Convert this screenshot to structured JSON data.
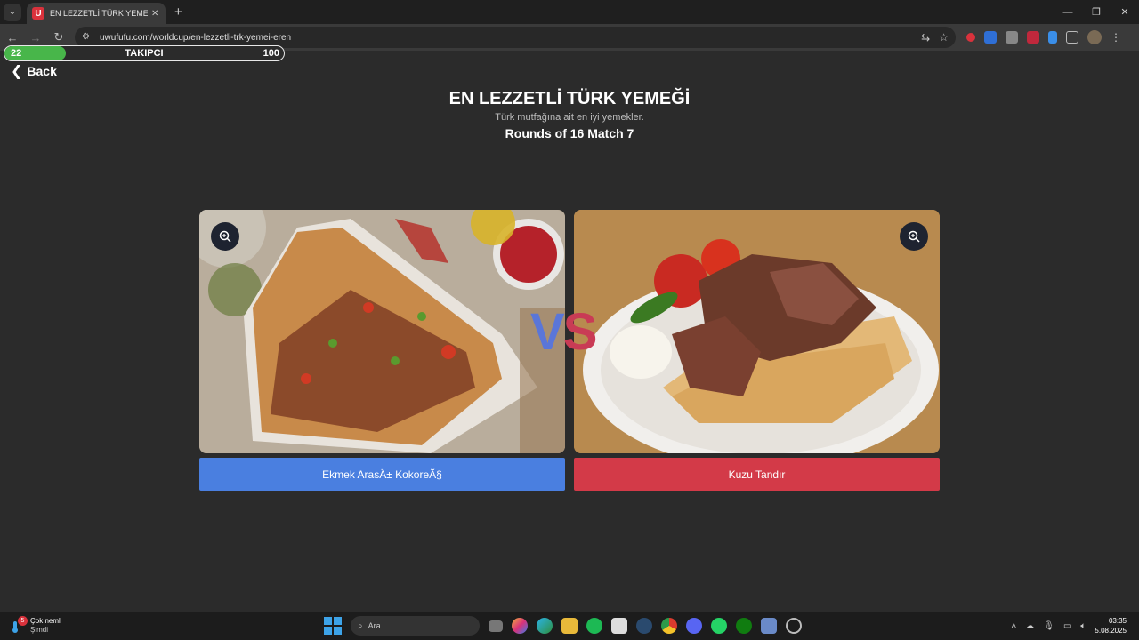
{
  "browser": {
    "tab_title": "EN LEZZETLİ TÜRK YEMEĞİ | Uw",
    "favicon_letter": "U",
    "url": "uwufufu.com/worldcup/en-lezzetli-trk-yemei-eren",
    "icons": [
      "tab-search-icon",
      "close-icon",
      "new-tab-icon",
      "back-icon",
      "forward-icon",
      "reload-icon",
      "site-info-icon",
      "translate-icon",
      "star-icon",
      "extensions-icon",
      "more-icon"
    ]
  },
  "progress": {
    "start": "22",
    "label": "TAKIPCI",
    "end": "100",
    "fill_fraction": 0.22,
    "fill_color": "#48b64a"
  },
  "nav": {
    "back_label": "Back"
  },
  "header": {
    "title": "EN LEZZETLİ TÜRK YEMEĞİ",
    "subtitle": "Türk mutfağına ait en iyi yemekler.",
    "round": "Rounds of 16 Match 7"
  },
  "match": {
    "vs_v": "V",
    "vs_s": "S",
    "left": {
      "label": "Ekmek ArasÄ± KokoreÃ§",
      "color": "#4a7fe0"
    },
    "right": {
      "label": "Kuzu Tandır",
      "color": "#d33a48"
    }
  },
  "taskbar": {
    "weather_badge": "5",
    "weather_title": "Çok nemli",
    "weather_sub": "Şimdi",
    "search_placeholder": "Ara",
    "time": "03:35",
    "date": "5.08.2025"
  }
}
